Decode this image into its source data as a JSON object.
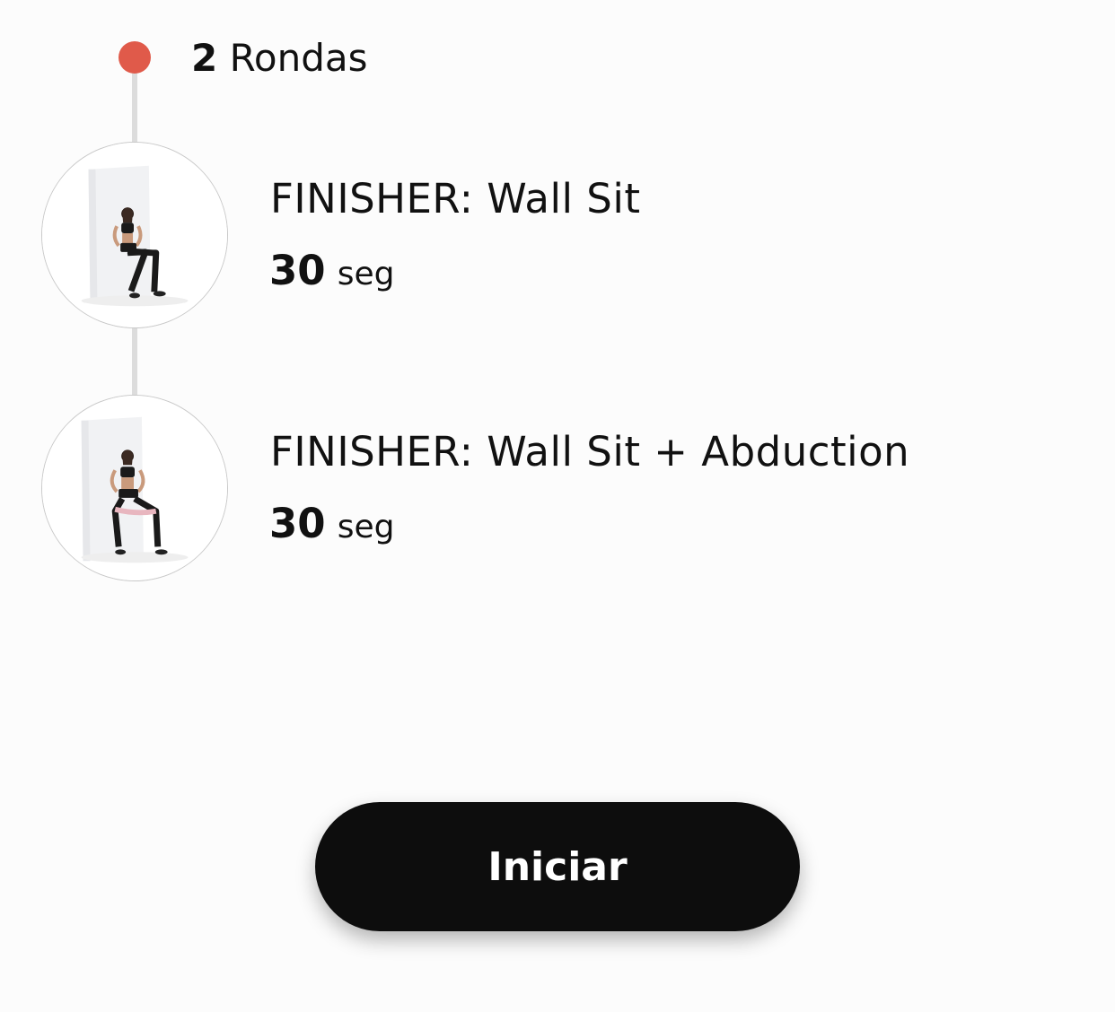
{
  "colors": {
    "accent": "#e05a4a",
    "button_bg": "#0d0d0d",
    "timeline_line": "#dcdcdc"
  },
  "rounds": {
    "count": "2",
    "label": "Rondas"
  },
  "exercises": [
    {
      "name": "FINISHER: Wall Sit",
      "duration_value": "30",
      "duration_unit": "seg",
      "thumbnail": "wall-sit-photo"
    },
    {
      "name": "FINISHER: Wall Sit + Abduction",
      "duration_value": "30",
      "duration_unit": "seg",
      "thumbnail": "wall-sit-abduction-photo"
    }
  ],
  "start_button": {
    "label": "Iniciar"
  }
}
